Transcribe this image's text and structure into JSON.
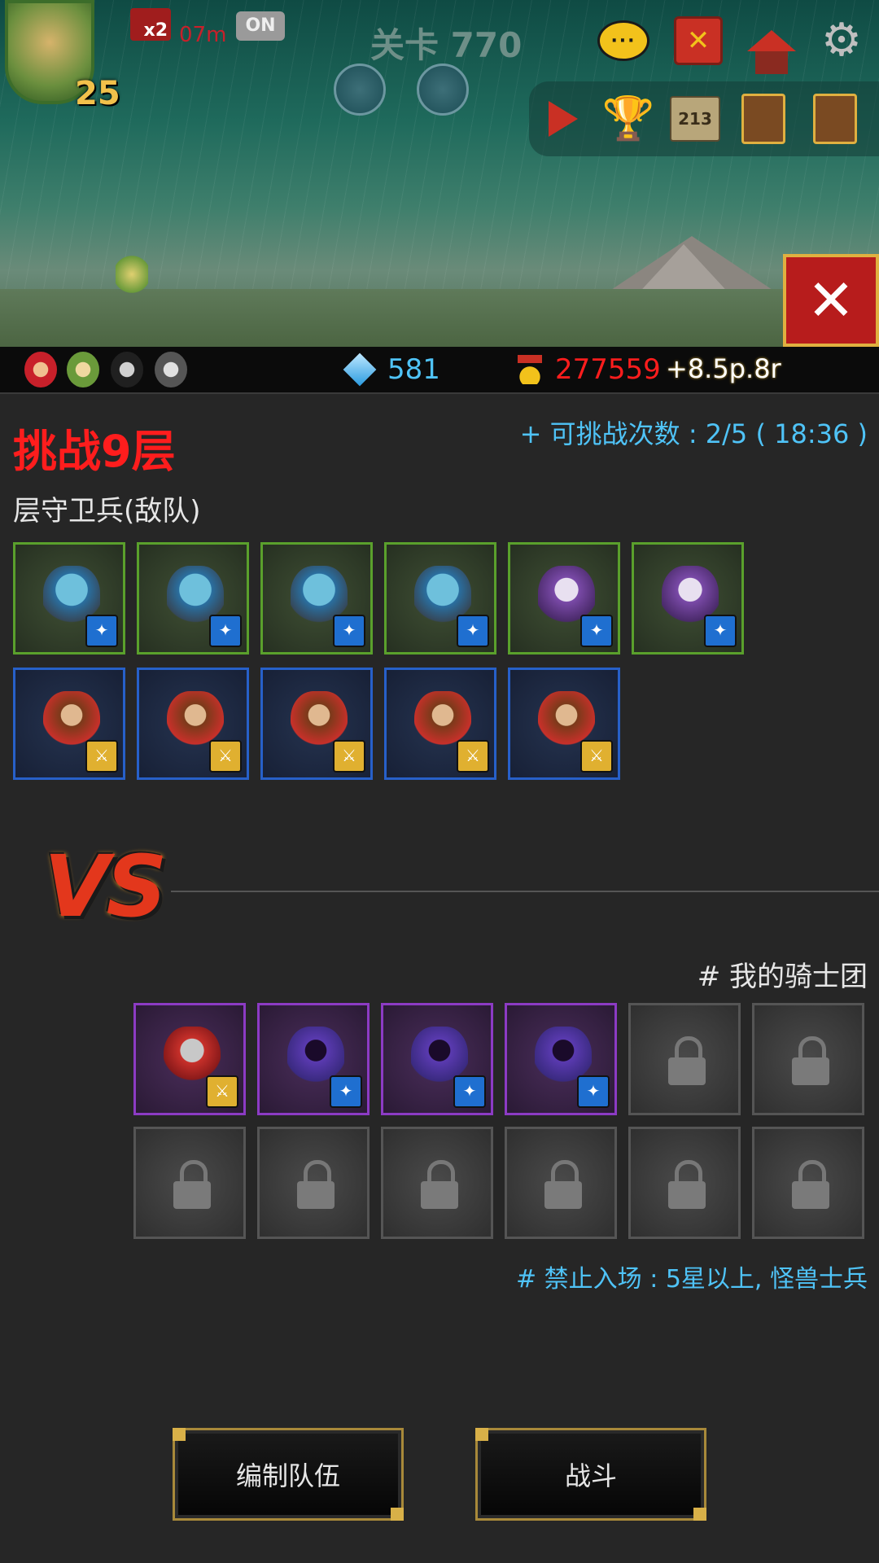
{
  "hud": {
    "hero_level": "25",
    "speed_label": "x2",
    "timer": "07m",
    "toggle": "ON",
    "stage_title": "关卡 770"
  },
  "resources": {
    "gems": "581",
    "gold": "277559",
    "income": "+8.5p.8r"
  },
  "challenge": {
    "title": "挑战9层",
    "attempts": "+ 可挑战次数 : 2/5 ( 18:36 )",
    "enemy_label": "层守卫兵(敌队)",
    "enemy_units": [
      {
        "type": "troll",
        "tier": "green",
        "class": "mage"
      },
      {
        "type": "troll",
        "tier": "green",
        "class": "mage"
      },
      {
        "type": "troll",
        "tier": "green",
        "class": "mage"
      },
      {
        "type": "troll",
        "tier": "green",
        "class": "mage"
      },
      {
        "type": "ghost",
        "tier": "green",
        "class": "mage"
      },
      {
        "type": "ghost",
        "tier": "green",
        "class": "mage"
      },
      {
        "type": "warrior",
        "tier": "blue",
        "class": "sword"
      },
      {
        "type": "warrior",
        "tier": "blue",
        "class": "sword"
      },
      {
        "type": "warrior",
        "tier": "blue",
        "class": "sword"
      },
      {
        "type": "warrior",
        "tier": "blue",
        "class": "sword"
      },
      {
        "type": "warrior",
        "tier": "blue",
        "class": "sword"
      }
    ]
  },
  "versus": {
    "vs_text": "VS",
    "my_team_label": "# 我的骑士团",
    "my_units": [
      {
        "type": "knight",
        "tier": "purple",
        "class": "sword"
      },
      {
        "type": "mage",
        "tier": "purple",
        "class": "mage"
      },
      {
        "type": "mage",
        "tier": "purple",
        "class": "mage"
      },
      {
        "type": "mage",
        "tier": "purple",
        "class": "mage"
      }
    ],
    "locked_slots": 8,
    "restriction": "# 禁止入场 : 5星以上, 怪兽士兵"
  },
  "buttons": {
    "edit_team": "编制队伍",
    "battle": "战斗"
  },
  "colors": {
    "accent_red": "#ff1d1d",
    "accent_blue": "#4fc3f7",
    "gold_border": "#a8893a"
  }
}
